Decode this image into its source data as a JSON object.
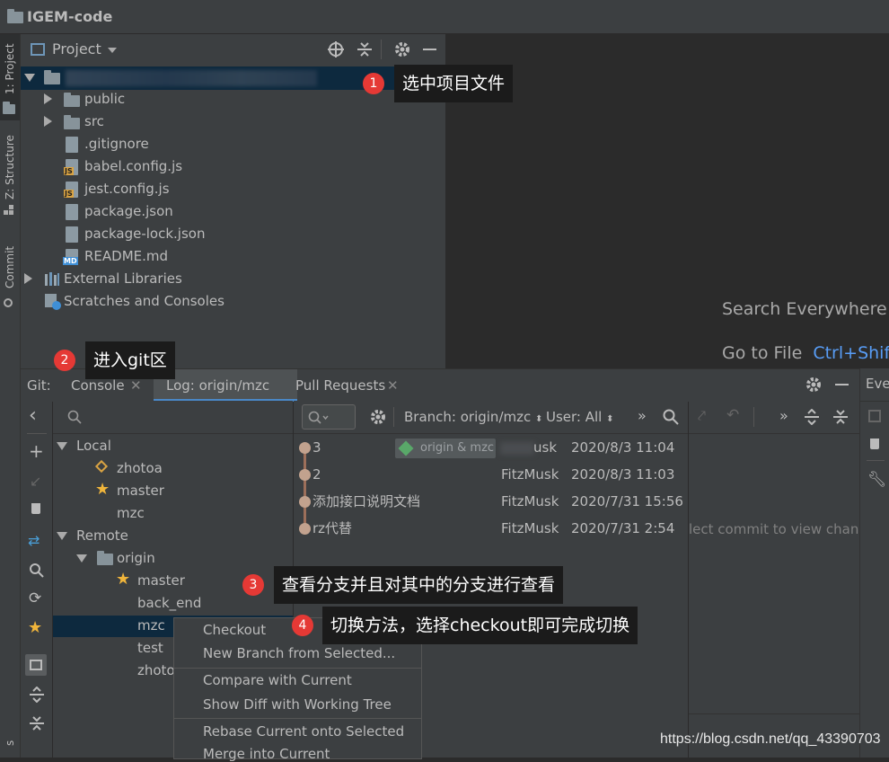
{
  "window": {
    "title": "IGEM-code"
  },
  "left_stripe": {
    "tabs": [
      "1: Project",
      "Z: Structure",
      "Commit"
    ]
  },
  "project_panel": {
    "title": "Project",
    "tree": [
      {
        "label": "public",
        "type": "folder"
      },
      {
        "label": "src",
        "type": "folder"
      },
      {
        "label": ".gitignore",
        "type": "file"
      },
      {
        "label": "babel.config.js",
        "type": "js"
      },
      {
        "label": "jest.config.js",
        "type": "js"
      },
      {
        "label": "package.json",
        "type": "json"
      },
      {
        "label": "package-lock.json",
        "type": "json"
      },
      {
        "label": "README.md",
        "type": "md"
      },
      {
        "label": "External Libraries",
        "type": "lib"
      },
      {
        "label": "Scratches and Consoles",
        "type": "scratch"
      }
    ]
  },
  "editor": {
    "hint1": "Search Everywhere",
    "hint2_label": "Go to File",
    "hint2_key": "Ctrl+Shif"
  },
  "git": {
    "label": "Git:",
    "tabs": [
      "Console",
      "Log: origin/mzc",
      "Pull Requests"
    ],
    "right_tab": "Eve",
    "filter": {
      "branch": "Branch: origin/mzc",
      "user": "User: All"
    },
    "branches": {
      "local_label": "Local",
      "local": [
        "zhotoa",
        "master",
        "mzc"
      ],
      "remote_label": "Remote",
      "origin_label": "origin",
      "origin": [
        "master",
        "back_end",
        "mzc",
        "test",
        "zhoto"
      ]
    },
    "commits": [
      {
        "msg": "3",
        "tag": "origin & mzc",
        "author": "usk",
        "date": "2020/8/3 11:04"
      },
      {
        "msg": "2",
        "author": "FitzMusk",
        "date": "2020/8/3 11:03"
      },
      {
        "msg": "添加接口说明文档",
        "author": "FitzMusk",
        "date": "2020/7/31 15:56"
      },
      {
        "msg": "rz代替",
        "author": "FitzMusk",
        "date": "2020/7/31 2:54"
      }
    ],
    "detail_hint": "lect commit to view chang"
  },
  "context_menu": {
    "items": [
      "Checkout",
      "New Branch from Selected...",
      "Compare with Current",
      "Show Diff with Working Tree",
      "Rebase Current onto Selected",
      "Merge into Current"
    ]
  },
  "callouts": [
    {
      "num": "1",
      "text": "选中项目文件"
    },
    {
      "num": "2",
      "text": "进入git区"
    },
    {
      "num": "3",
      "text": "查看分支并且对其中的分支进行查看"
    },
    {
      "num": "4",
      "text": "切换方法，选择checkout即可完成切换"
    }
  ],
  "watermark": "https://blog.csdn.net/qq_43390703"
}
